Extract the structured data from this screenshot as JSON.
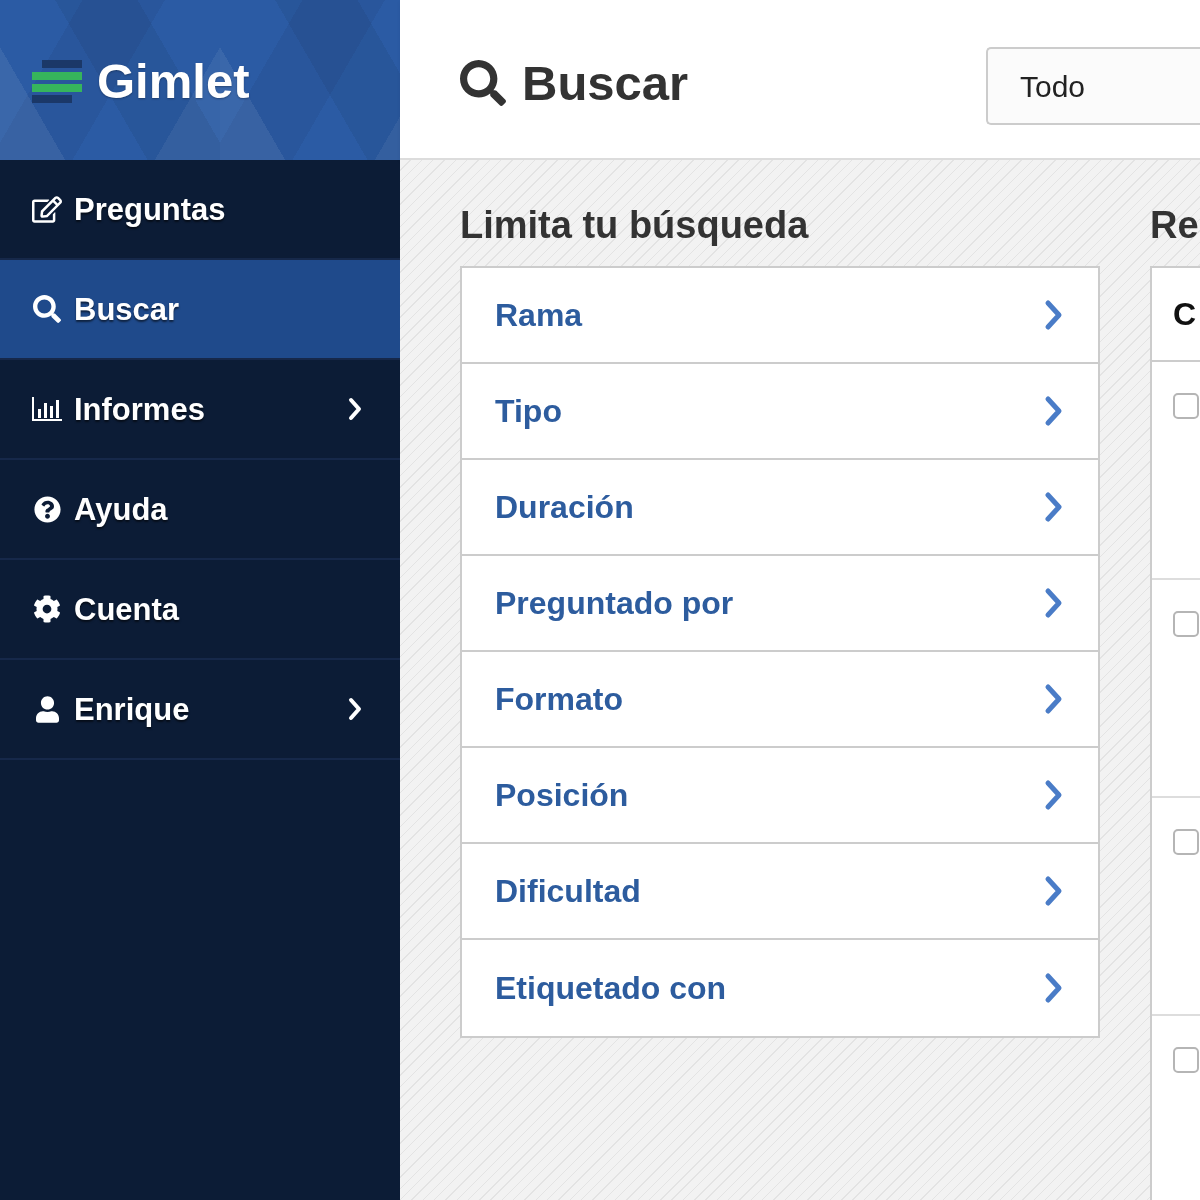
{
  "sidebar": {
    "logo": {
      "name": "Gimlet"
    },
    "items": [
      {
        "label": "Preguntas",
        "selected": false,
        "has_submenu": false
      },
      {
        "label": "Buscar",
        "selected": true,
        "has_submenu": false
      },
      {
        "label": "Informes",
        "selected": false,
        "has_submenu": true
      },
      {
        "label": "Ayuda",
        "selected": false,
        "has_submenu": false
      },
      {
        "label": "Cuenta",
        "selected": false,
        "has_submenu": false
      },
      {
        "label": "Enrique",
        "selected": false,
        "has_submenu": true
      }
    ]
  },
  "header": {
    "title": "Buscar",
    "scope_select": {
      "value": "Todo"
    }
  },
  "filters": {
    "heading": "Limita tu búsqueda",
    "items": [
      {
        "label": "Rama"
      },
      {
        "label": "Tipo"
      },
      {
        "label": "Duración"
      },
      {
        "label": "Preguntado por"
      },
      {
        "label": "Formato"
      },
      {
        "label": "Posición"
      },
      {
        "label": "Dificultad"
      },
      {
        "label": "Etiquetado con"
      }
    ]
  },
  "results": {
    "heading": "Re",
    "column_1": "C",
    "rows": [
      {
        "checked": false
      },
      {
        "checked": false
      },
      {
        "checked": false
      },
      {
        "checked": false
      }
    ]
  }
}
